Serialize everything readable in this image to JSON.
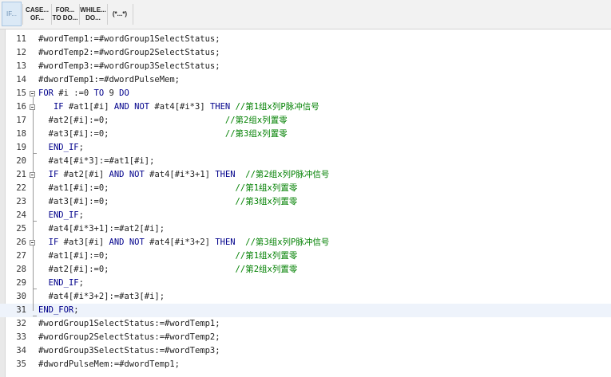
{
  "toolbar": {
    "buttons": [
      {
        "lines": [
          "IF..."
        ],
        "active": true
      },
      {
        "lines": [
          "CASE...",
          "OF..."
        ],
        "active": false
      },
      {
        "lines": [
          "FOR...",
          "TO DO..."
        ],
        "active": false
      },
      {
        "lines": [
          "WHILE...",
          "DO..."
        ],
        "active": false
      },
      {
        "lines": [
          "(*...*)"
        ],
        "active": false
      }
    ]
  },
  "editor": {
    "current_line": 31,
    "lines": [
      {
        "n": "11",
        "segments": [
          {
            "t": "#wordTemp1:=#wordGroup1SelectStatus;",
            "c": "p"
          }
        ]
      },
      {
        "n": "12",
        "segments": [
          {
            "t": "#wordTemp2:=#wordGroup2SelectStatus;",
            "c": "p"
          }
        ]
      },
      {
        "n": "13",
        "segments": [
          {
            "t": "#wordTemp3:=#wordGroup3SelectStatus;",
            "c": "p"
          }
        ]
      },
      {
        "n": "14",
        "segments": [
          {
            "t": "#dwordTemp1:=#dwordPulseMem;",
            "c": "p"
          }
        ]
      },
      {
        "n": "15",
        "segments": [
          {
            "t": "FOR",
            "c": "kw"
          },
          {
            "t": " #i :=0 ",
            "c": "p"
          },
          {
            "t": "TO",
            "c": "kw"
          },
          {
            "t": " 9 ",
            "c": "p"
          },
          {
            "t": "DO",
            "c": "kw"
          }
        ]
      },
      {
        "n": "16",
        "segments": [
          {
            "t": "   ",
            "c": "p"
          },
          {
            "t": "IF",
            "c": "kw"
          },
          {
            "t": " #at1[#i] ",
            "c": "p"
          },
          {
            "t": "AND NOT",
            "c": "kw"
          },
          {
            "t": " #at4[#i*3] ",
            "c": "p"
          },
          {
            "t": "THEN",
            "c": "kw"
          },
          {
            "t": " ",
            "c": "p"
          },
          {
            "t": "//第1组x列P脉冲信号",
            "c": "cm"
          }
        ]
      },
      {
        "n": "17",
        "segments": [
          {
            "t": "  #at2[#i]:=0;                       ",
            "c": "p"
          },
          {
            "t": "//第2组x列置零",
            "c": "cm"
          }
        ]
      },
      {
        "n": "18",
        "segments": [
          {
            "t": "  #at3[#i]:=0;                       ",
            "c": "p"
          },
          {
            "t": "//第3组x列置零",
            "c": "cm"
          }
        ]
      },
      {
        "n": "19",
        "segments": [
          {
            "t": "  ",
            "c": "p"
          },
          {
            "t": "END_IF",
            "c": "kw"
          },
          {
            "t": ";",
            "c": "p"
          }
        ]
      },
      {
        "n": "20",
        "segments": [
          {
            "t": "  #at4[#i*3]:=#at1[#i];",
            "c": "p"
          }
        ]
      },
      {
        "n": "21",
        "segments": [
          {
            "t": "  ",
            "c": "p"
          },
          {
            "t": "IF",
            "c": "kw"
          },
          {
            "t": " #at2[#i] ",
            "c": "p"
          },
          {
            "t": "AND NOT",
            "c": "kw"
          },
          {
            "t": " #at4[#i*3+1] ",
            "c": "p"
          },
          {
            "t": "THEN",
            "c": "kw"
          },
          {
            "t": "  ",
            "c": "p"
          },
          {
            "t": "//第2组x列P脉冲信号",
            "c": "cm"
          }
        ]
      },
      {
        "n": "22",
        "segments": [
          {
            "t": "  #at1[#i]:=0;                         ",
            "c": "p"
          },
          {
            "t": "//第1组x列置零",
            "c": "cm"
          }
        ]
      },
      {
        "n": "23",
        "segments": [
          {
            "t": "  #at3[#i]:=0;                         ",
            "c": "p"
          },
          {
            "t": "//第3组x列置零",
            "c": "cm"
          }
        ]
      },
      {
        "n": "24",
        "segments": [
          {
            "t": "  ",
            "c": "p"
          },
          {
            "t": "END_IF",
            "c": "kw"
          },
          {
            "t": ";",
            "c": "p"
          }
        ]
      },
      {
        "n": "25",
        "segments": [
          {
            "t": "  #at4[#i*3+1]:=#at2[#i];",
            "c": "p"
          }
        ]
      },
      {
        "n": "26",
        "segments": [
          {
            "t": "  ",
            "c": "p"
          },
          {
            "t": "IF",
            "c": "kw"
          },
          {
            "t": " #at3[#i] ",
            "c": "p"
          },
          {
            "t": "AND NOT",
            "c": "kw"
          },
          {
            "t": " #at4[#i*3+2] ",
            "c": "p"
          },
          {
            "t": "THEN",
            "c": "kw"
          },
          {
            "t": "  ",
            "c": "p"
          },
          {
            "t": "//第3组x列P脉冲信号",
            "c": "cm"
          }
        ]
      },
      {
        "n": "27",
        "segments": [
          {
            "t": "  #at1[#i]:=0;                         ",
            "c": "p"
          },
          {
            "t": "//第1组x列置零",
            "c": "cm"
          }
        ]
      },
      {
        "n": "28",
        "segments": [
          {
            "t": "  #at2[#i]:=0;                         ",
            "c": "p"
          },
          {
            "t": "//第2组x列置零",
            "c": "cm"
          }
        ]
      },
      {
        "n": "29",
        "segments": [
          {
            "t": "  ",
            "c": "p"
          },
          {
            "t": "END_IF",
            "c": "kw"
          },
          {
            "t": ";",
            "c": "p"
          }
        ]
      },
      {
        "n": "30",
        "segments": [
          {
            "t": "  #at4[#i*3+2]:=#at3[#i];",
            "c": "p"
          }
        ]
      },
      {
        "n": "31",
        "segments": [
          {
            "t": "END_FOR",
            "c": "kw"
          },
          {
            "t": ";",
            "c": "p"
          }
        ]
      },
      {
        "n": "32",
        "segments": [
          {
            "t": "#wordGroup1SelectStatus:=#wordTemp1;",
            "c": "p"
          }
        ]
      },
      {
        "n": "33",
        "segments": [
          {
            "t": "#wordGroup2SelectStatus:=#wordTemp2;",
            "c": "p"
          }
        ]
      },
      {
        "n": "34",
        "segments": [
          {
            "t": "#wordGroup3SelectStatus:=#wordTemp3;",
            "c": "p"
          }
        ]
      },
      {
        "n": "35",
        "segments": [
          {
            "t": "#dwordPulseMem:=#dwordTemp1;",
            "c": "p"
          }
        ]
      }
    ]
  }
}
